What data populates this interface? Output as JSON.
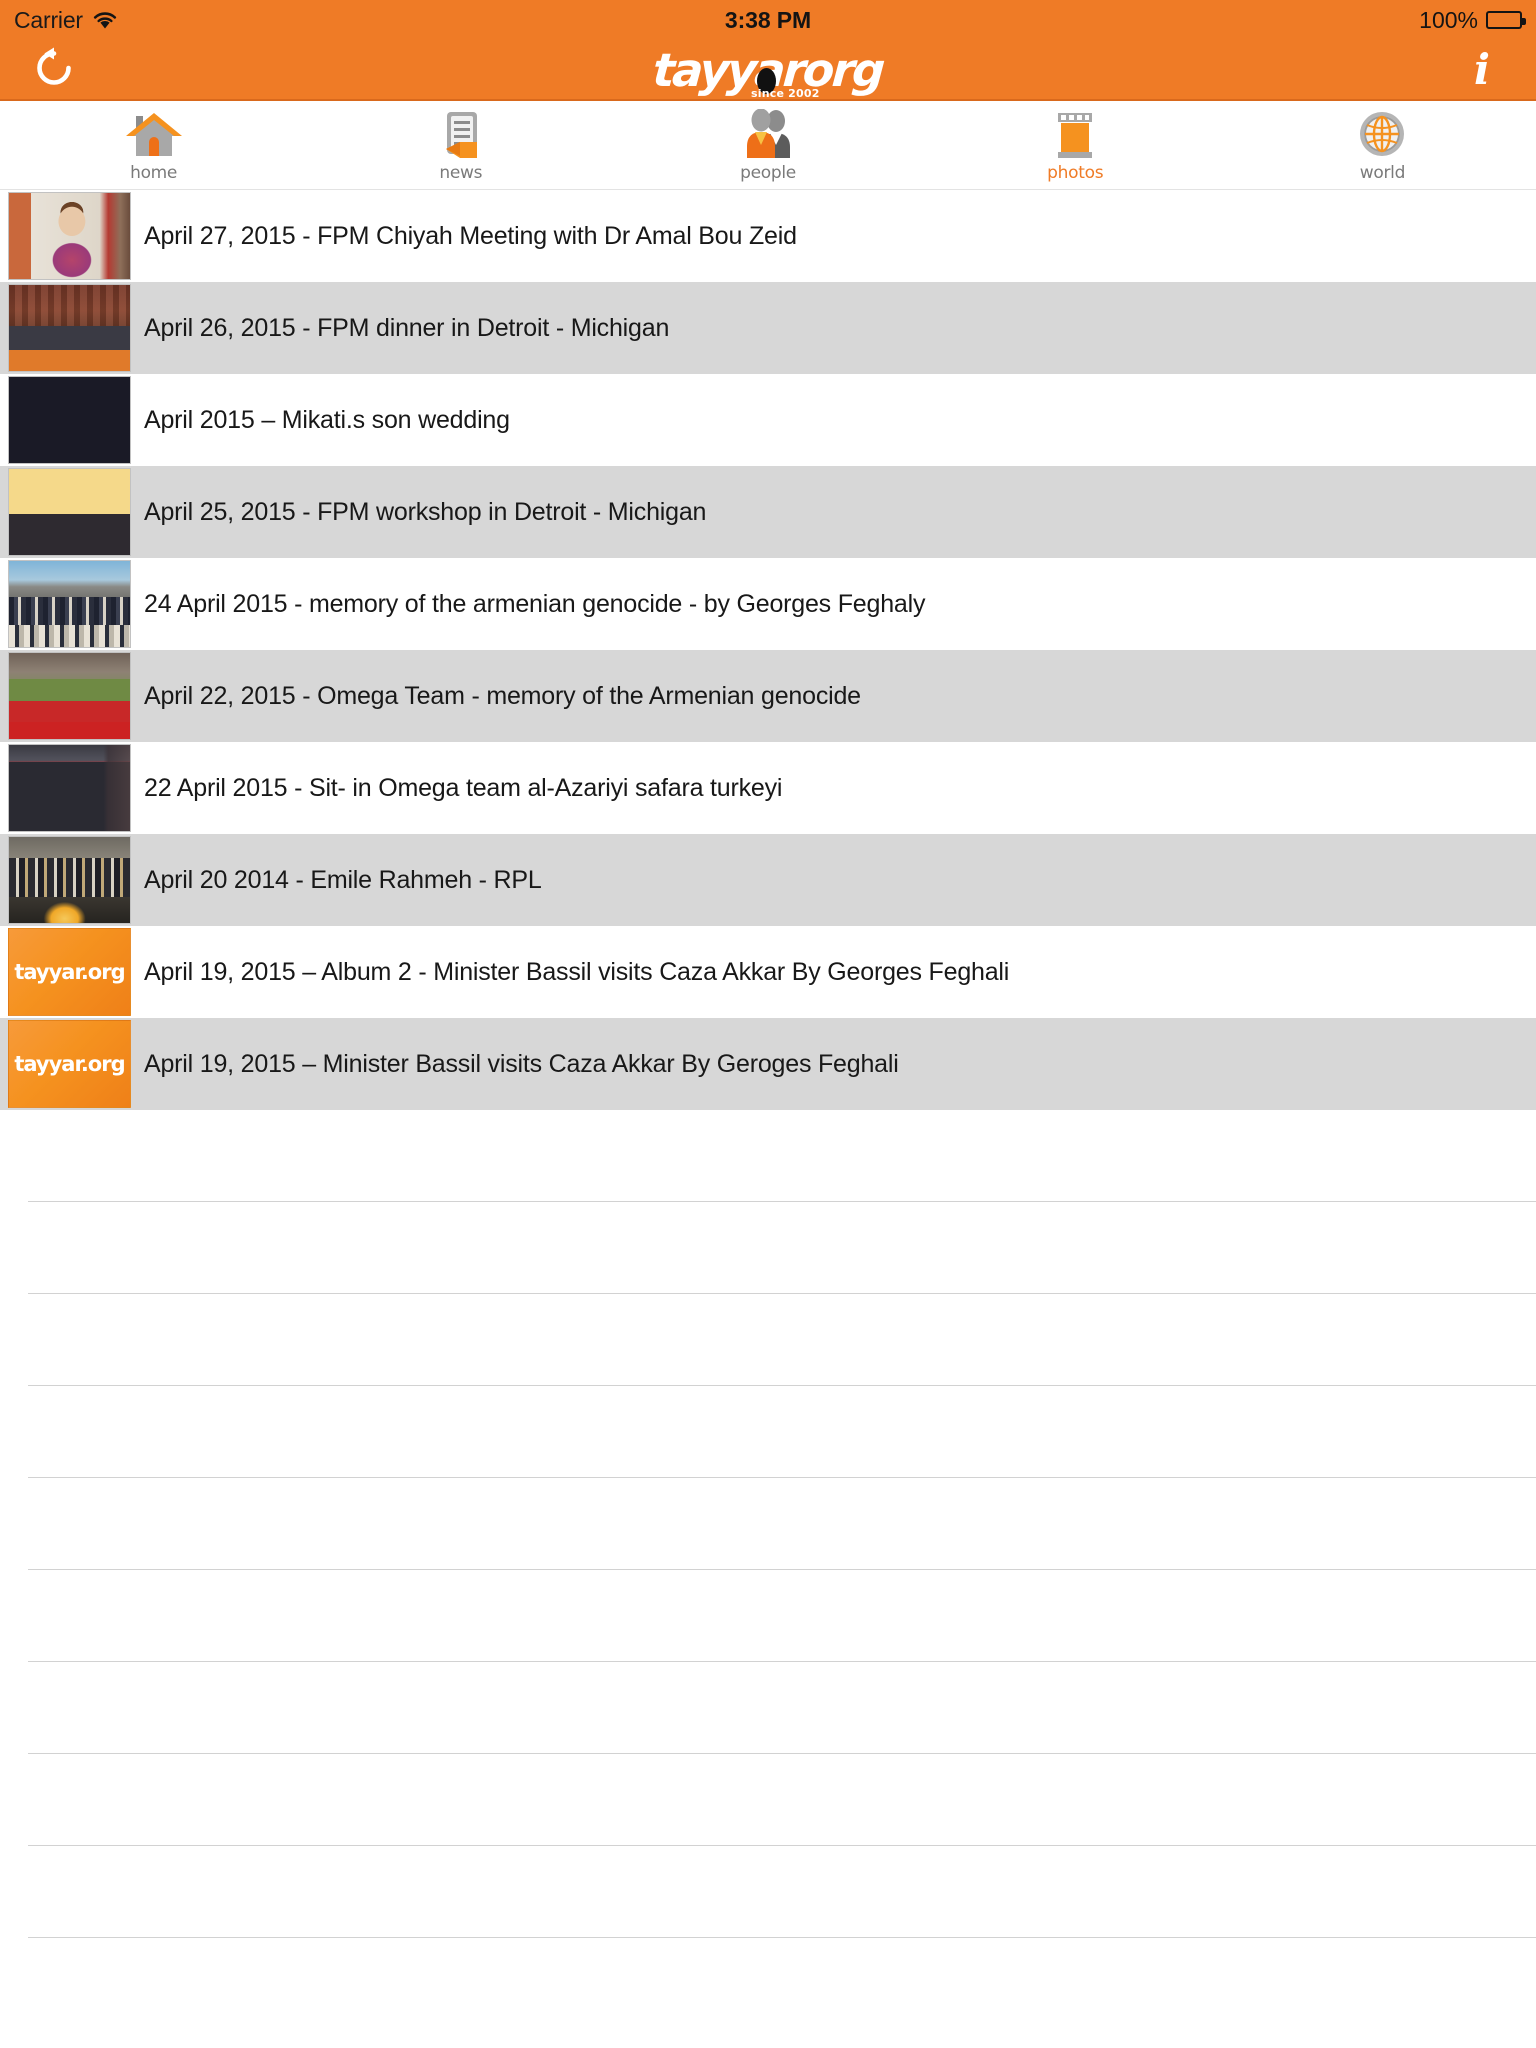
{
  "status_bar": {
    "carrier": "Carrier",
    "wifi_icon": "wifi-icon",
    "time": "3:38 PM",
    "battery_percent": "100%",
    "battery_icon": "battery-full-icon"
  },
  "nav_bar": {
    "refresh_icon": "refresh-icon",
    "info_icon": "info-icon",
    "brand": "tayyar",
    "brand_suffix": "org",
    "brand_tagline": "since 2002",
    "accent_color": "#ef7b26"
  },
  "tabs": [
    {
      "label": "home",
      "icon": "home-icon",
      "active": false
    },
    {
      "label": "news",
      "icon": "news-icon",
      "active": false
    },
    {
      "label": "people",
      "icon": "people-icon",
      "active": false
    },
    {
      "label": "photos",
      "icon": "photos-icon",
      "active": true
    },
    {
      "label": "world",
      "icon": "world-icon",
      "active": false
    }
  ],
  "list": {
    "items": [
      {
        "title": "April 27, 2015 - FPM Chiyah Meeting with Dr Amal Bou Zeid",
        "thumb": "photo-woman-red-dress"
      },
      {
        "title": "April 26, 2015 - FPM dinner in Detroit - Michigan",
        "thumb": "photo-dinner-table"
      },
      {
        "title": "April 2015 – Mikati.s son wedding",
        "thumb": "photo-wedding-couple"
      },
      {
        "title": "April 25, 2015 - FPM workshop in Detroit - Michigan",
        "thumb": "photo-workshop-hall"
      },
      {
        "title": "24 April 2015 - memory of the armenian genocide - by Georges Feghaly",
        "thumb": "photo-street-crowd"
      },
      {
        "title": "April 22, 2015 - Omega Team  - memory of the Armenian genocide",
        "thumb": "photo-street-protest"
      },
      {
        "title": "22 April 2015 - Sit- in Omega team al-Azariyi safara turkeyi",
        "thumb": "photo-turkish-flag"
      },
      {
        "title": "April 20 2014 - Emile Rahmeh - RPL",
        "thumb": "photo-group-stage"
      },
      {
        "title": "April 19, 2015 – Album 2 -  Minister Bassil visits Caza Akkar By Georges Feghali",
        "thumb": "logo-placeholder"
      },
      {
        "title": "April 19, 2015 – Minister Bassil visits Caza Akkar By Geroges Feghali",
        "thumb": "logo-placeholder"
      }
    ],
    "logo_placeholder_text": "tayyar.org",
    "empty_row_count": 9
  }
}
